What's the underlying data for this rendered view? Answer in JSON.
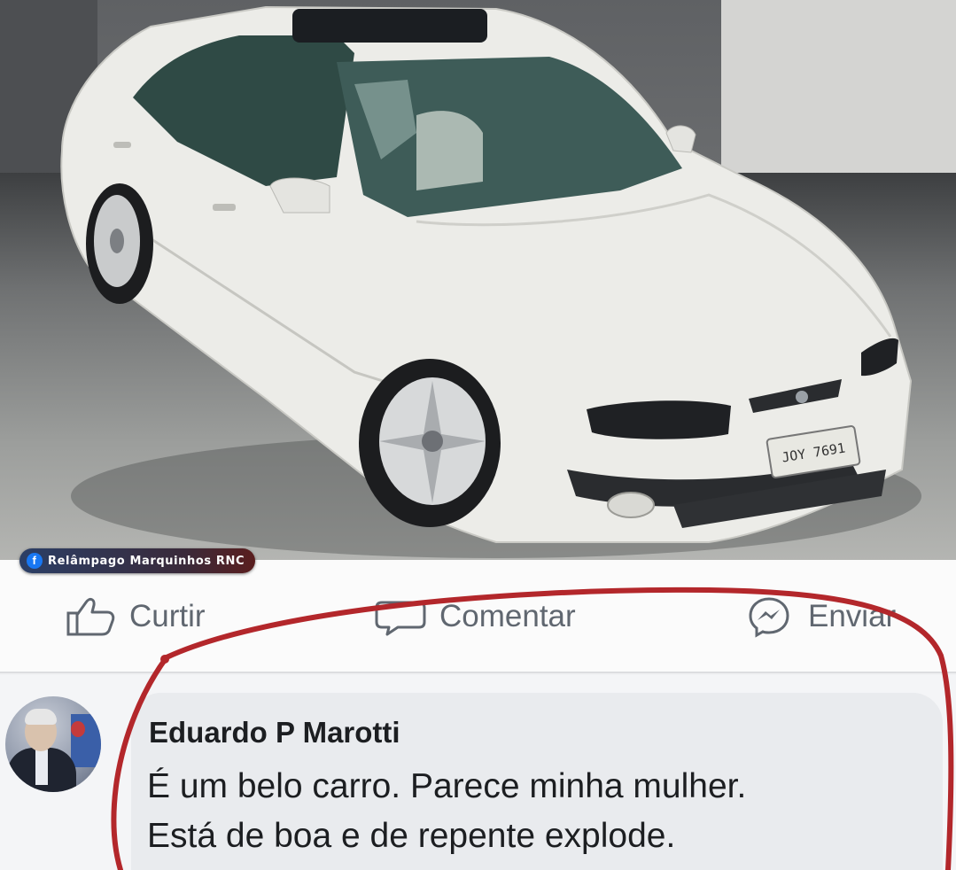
{
  "photo": {
    "plate_text": "JOY 7691",
    "page_badge": {
      "icon": "facebook-icon",
      "label": "Relâmpago Marquinhos RNC"
    }
  },
  "actions": {
    "like_label": "Curtir",
    "comment_label": "Comentar",
    "send_label": "Enviar",
    "like_icon": "thumbs-up-icon",
    "comment_icon": "comment-bubble-icon",
    "send_icon": "messenger-icon"
  },
  "comment": {
    "author": "Eduardo P Marotti",
    "line1": "É um belo carro. Parece minha mulher.",
    "line2": "Está de boa e de repente explode."
  },
  "colors": {
    "action_text": "#606770",
    "comment_bg": "#e9ebee",
    "marker_red": "#b3272b",
    "facebook_blue": "#1877f2"
  }
}
